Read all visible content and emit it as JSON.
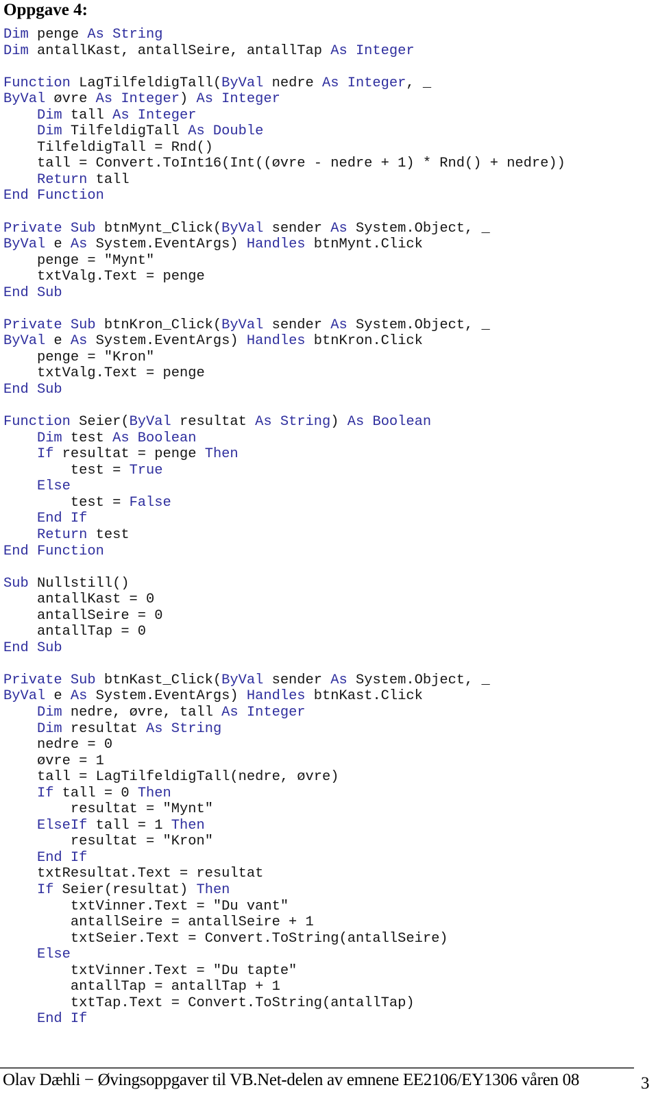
{
  "document": {
    "heading": "Oppgave 4:",
    "code_lines": [
      {
        "indent": 0,
        "tokens": [
          [
            "kw",
            "Dim"
          ],
          [
            "plain",
            " penge "
          ],
          [
            "kw",
            "As String"
          ]
        ]
      },
      {
        "indent": 0,
        "tokens": [
          [
            "kw",
            "Dim"
          ],
          [
            "plain",
            " antallKast, antallSeire, antallTap "
          ],
          [
            "kw",
            "As Integer"
          ]
        ]
      },
      {
        "indent": 0,
        "tokens": []
      },
      {
        "indent": 0,
        "tokens": [
          [
            "kw",
            "Function"
          ],
          [
            "plain",
            " LagTilfeldigTall("
          ],
          [
            "kw",
            "ByVal"
          ],
          [
            "plain",
            " nedre "
          ],
          [
            "kw",
            "As Integer"
          ],
          [
            "plain",
            ", _"
          ]
        ]
      },
      {
        "indent": 0,
        "tokens": [
          [
            "kw",
            "ByVal"
          ],
          [
            "plain",
            " øvre "
          ],
          [
            "kw",
            "As Integer"
          ],
          [
            "plain",
            ") "
          ],
          [
            "kw",
            "As Integer"
          ]
        ]
      },
      {
        "indent": 1,
        "tokens": [
          [
            "kw",
            "Dim"
          ],
          [
            "plain",
            " tall "
          ],
          [
            "kw",
            "As Integer"
          ]
        ]
      },
      {
        "indent": 1,
        "tokens": [
          [
            "kw",
            "Dim"
          ],
          [
            "plain",
            " TilfeldigTall "
          ],
          [
            "kw",
            "As Double"
          ]
        ]
      },
      {
        "indent": 1,
        "tokens": [
          [
            "plain",
            "TilfeldigTall = Rnd()"
          ]
        ]
      },
      {
        "indent": 1,
        "tokens": [
          [
            "plain",
            "tall = Convert.ToInt16(Int((øvre - nedre + 1) * Rnd() + nedre))"
          ]
        ]
      },
      {
        "indent": 1,
        "tokens": [
          [
            "kw",
            "Return"
          ],
          [
            "plain",
            " tall"
          ]
        ]
      },
      {
        "indent": 0,
        "tokens": [
          [
            "kw",
            "End Function"
          ]
        ]
      },
      {
        "indent": 0,
        "tokens": []
      },
      {
        "indent": 0,
        "tokens": [
          [
            "kw",
            "Private Sub"
          ],
          [
            "plain",
            " btnMynt_Click("
          ],
          [
            "kw",
            "ByVal"
          ],
          [
            "plain",
            " sender "
          ],
          [
            "kw",
            "As"
          ],
          [
            "plain",
            " System.Object, _"
          ]
        ]
      },
      {
        "indent": 0,
        "tokens": [
          [
            "kw",
            "ByVal"
          ],
          [
            "plain",
            " e "
          ],
          [
            "kw",
            "As"
          ],
          [
            "plain",
            " System.EventArgs) "
          ],
          [
            "kw",
            "Handles"
          ],
          [
            "plain",
            " btnMynt.Click"
          ]
        ]
      },
      {
        "indent": 1,
        "tokens": [
          [
            "plain",
            "penge = \"Mynt\""
          ]
        ]
      },
      {
        "indent": 1,
        "tokens": [
          [
            "plain",
            "txtValg.Text = penge"
          ]
        ]
      },
      {
        "indent": 0,
        "tokens": [
          [
            "kw",
            "End Sub"
          ]
        ]
      },
      {
        "indent": 0,
        "tokens": []
      },
      {
        "indent": 0,
        "tokens": [
          [
            "kw",
            "Private Sub"
          ],
          [
            "plain",
            " btnKron_Click("
          ],
          [
            "kw",
            "ByVal"
          ],
          [
            "plain",
            " sender "
          ],
          [
            "kw",
            "As"
          ],
          [
            "plain",
            " System.Object, _"
          ]
        ]
      },
      {
        "indent": 0,
        "tokens": [
          [
            "kw",
            "ByVal"
          ],
          [
            "plain",
            " e "
          ],
          [
            "kw",
            "As"
          ],
          [
            "plain",
            " System.EventArgs) "
          ],
          [
            "kw",
            "Handles"
          ],
          [
            "plain",
            " btnKron.Click"
          ]
        ]
      },
      {
        "indent": 1,
        "tokens": [
          [
            "plain",
            "penge = \"Kron\""
          ]
        ]
      },
      {
        "indent": 1,
        "tokens": [
          [
            "plain",
            "txtValg.Text = penge"
          ]
        ]
      },
      {
        "indent": 0,
        "tokens": [
          [
            "kw",
            "End Sub"
          ]
        ]
      },
      {
        "indent": 0,
        "tokens": []
      },
      {
        "indent": 0,
        "tokens": [
          [
            "kw",
            "Function"
          ],
          [
            "plain",
            " Seier("
          ],
          [
            "kw",
            "ByVal"
          ],
          [
            "plain",
            " resultat "
          ],
          [
            "kw",
            "As String"
          ],
          [
            "plain",
            ") "
          ],
          [
            "kw",
            "As Boolean"
          ]
        ]
      },
      {
        "indent": 1,
        "tokens": [
          [
            "kw",
            "Dim"
          ],
          [
            "plain",
            " test "
          ],
          [
            "kw",
            "As Boolean"
          ]
        ]
      },
      {
        "indent": 1,
        "tokens": [
          [
            "kw",
            "If"
          ],
          [
            "plain",
            " resultat = penge "
          ],
          [
            "kw",
            "Then"
          ]
        ]
      },
      {
        "indent": 2,
        "tokens": [
          [
            "plain",
            "test = "
          ],
          [
            "kw",
            "True"
          ]
        ]
      },
      {
        "indent": 1,
        "tokens": [
          [
            "kw",
            "Else"
          ]
        ]
      },
      {
        "indent": 2,
        "tokens": [
          [
            "plain",
            "test = "
          ],
          [
            "kw",
            "False"
          ]
        ]
      },
      {
        "indent": 1,
        "tokens": [
          [
            "kw",
            "End If"
          ]
        ]
      },
      {
        "indent": 1,
        "tokens": [
          [
            "kw",
            "Return"
          ],
          [
            "plain",
            " test"
          ]
        ]
      },
      {
        "indent": 0,
        "tokens": [
          [
            "kw",
            "End Function"
          ]
        ]
      },
      {
        "indent": 0,
        "tokens": []
      },
      {
        "indent": 0,
        "tokens": [
          [
            "kw",
            "Sub"
          ],
          [
            "plain",
            " Nullstill()"
          ]
        ]
      },
      {
        "indent": 1,
        "tokens": [
          [
            "plain",
            "antallKast = 0"
          ]
        ]
      },
      {
        "indent": 1,
        "tokens": [
          [
            "plain",
            "antallSeire = 0"
          ]
        ]
      },
      {
        "indent": 1,
        "tokens": [
          [
            "plain",
            "antallTap = 0"
          ]
        ]
      },
      {
        "indent": 0,
        "tokens": [
          [
            "kw",
            "End Sub"
          ]
        ]
      },
      {
        "indent": 0,
        "tokens": []
      },
      {
        "indent": 0,
        "tokens": [
          [
            "kw",
            "Private Sub"
          ],
          [
            "plain",
            " btnKast_Click("
          ],
          [
            "kw",
            "ByVal"
          ],
          [
            "plain",
            " sender "
          ],
          [
            "kw",
            "As"
          ],
          [
            "plain",
            " System.Object, _"
          ]
        ]
      },
      {
        "indent": 0,
        "tokens": [
          [
            "kw",
            "ByVal"
          ],
          [
            "plain",
            " e "
          ],
          [
            "kw",
            "As"
          ],
          [
            "plain",
            " System.EventArgs) "
          ],
          [
            "kw",
            "Handles"
          ],
          [
            "plain",
            " btnKast.Click"
          ]
        ]
      },
      {
        "indent": 1,
        "tokens": [
          [
            "kw",
            "Dim"
          ],
          [
            "plain",
            " nedre, øvre, tall "
          ],
          [
            "kw",
            "As Integer"
          ]
        ]
      },
      {
        "indent": 1,
        "tokens": [
          [
            "kw",
            "Dim"
          ],
          [
            "plain",
            " resultat "
          ],
          [
            "kw",
            "As String"
          ]
        ]
      },
      {
        "indent": 1,
        "tokens": [
          [
            "plain",
            "nedre = 0"
          ]
        ]
      },
      {
        "indent": 1,
        "tokens": [
          [
            "plain",
            "øvre = 1"
          ]
        ]
      },
      {
        "indent": 1,
        "tokens": [
          [
            "plain",
            "tall = LagTilfeldigTall(nedre, øvre)"
          ]
        ]
      },
      {
        "indent": 1,
        "tokens": [
          [
            "kw",
            "If"
          ],
          [
            "plain",
            " tall = 0 "
          ],
          [
            "kw",
            "Then"
          ]
        ]
      },
      {
        "indent": 2,
        "tokens": [
          [
            "plain",
            "resultat = \"Mynt\""
          ]
        ]
      },
      {
        "indent": 1,
        "tokens": [
          [
            "kw",
            "ElseIf"
          ],
          [
            "plain",
            " tall = 1 "
          ],
          [
            "kw",
            "Then"
          ]
        ]
      },
      {
        "indent": 2,
        "tokens": [
          [
            "plain",
            "resultat = \"Kron\""
          ]
        ]
      },
      {
        "indent": 1,
        "tokens": [
          [
            "kw",
            "End If"
          ]
        ]
      },
      {
        "indent": 1,
        "tokens": [
          [
            "plain",
            "txtResultat.Text = resultat"
          ]
        ]
      },
      {
        "indent": 1,
        "tokens": [
          [
            "kw",
            "If"
          ],
          [
            "plain",
            " Seier(resultat) "
          ],
          [
            "kw",
            "Then"
          ]
        ]
      },
      {
        "indent": 2,
        "tokens": [
          [
            "plain",
            "txtVinner.Text = \"Du vant\""
          ]
        ]
      },
      {
        "indent": 2,
        "tokens": [
          [
            "plain",
            "antallSeire = antallSeire + 1"
          ]
        ]
      },
      {
        "indent": 2,
        "tokens": [
          [
            "plain",
            "txtSeier.Text = Convert.ToString(antallSeire)"
          ]
        ]
      },
      {
        "indent": 1,
        "tokens": [
          [
            "kw",
            "Else"
          ]
        ]
      },
      {
        "indent": 2,
        "tokens": [
          [
            "plain",
            "txtVinner.Text = \"Du tapte\""
          ]
        ]
      },
      {
        "indent": 2,
        "tokens": [
          [
            "plain",
            "antallTap = antallTap + 1"
          ]
        ]
      },
      {
        "indent": 2,
        "tokens": [
          [
            "plain",
            "txtTap.Text = Convert.ToString(antallTap)"
          ]
        ]
      },
      {
        "indent": 1,
        "tokens": [
          [
            "kw",
            "End If"
          ]
        ]
      }
    ]
  },
  "footer": {
    "text": "Olav Dæhli − Øvingsoppgaver til VB.Net-delen av emnene EE2106/EY1306 våren 08",
    "page_number": "3"
  },
  "colors": {
    "keyword": "#2e2e9e",
    "identifier": "#141414"
  }
}
